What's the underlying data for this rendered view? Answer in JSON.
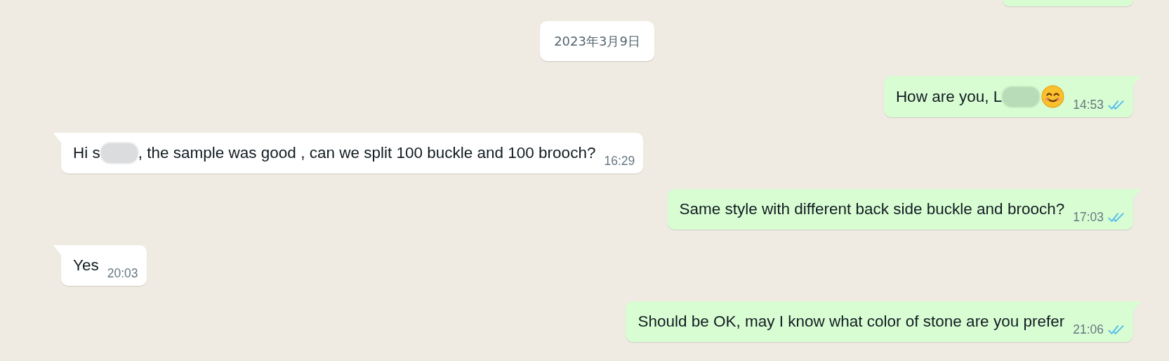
{
  "messages": [
    {
      "kind": "outgoing",
      "cropped": true
    },
    {
      "kind": "date",
      "text": "2023年3月9日"
    },
    {
      "kind": "outgoing",
      "parts": [
        {
          "kind": "text",
          "text": "How are you, L"
        },
        {
          "kind": "blur"
        },
        {
          "kind": "emoji"
        }
      ],
      "time": "14:53",
      "read": true
    },
    {
      "kind": "incoming",
      "parts": [
        {
          "kind": "text",
          "text": "Hi s"
        },
        {
          "kind": "blur"
        },
        {
          "kind": "text",
          "text": ", the sample was good , can we split 100 buckle and 100 brooch?"
        }
      ],
      "time": "16:29"
    },
    {
      "kind": "outgoing",
      "parts": [
        {
          "kind": "text",
          "text": "Same style with different back side buckle and brooch?"
        }
      ],
      "time": "17:03",
      "read": true
    },
    {
      "kind": "incoming",
      "parts": [
        {
          "kind": "text",
          "text": "Yes"
        }
      ],
      "time": "20:03"
    },
    {
      "kind": "outgoing",
      "parts": [
        {
          "kind": "text",
          "text": "Should be OK, may I know what color of stone are you prefer"
        }
      ],
      "time": "21:06",
      "read": true
    }
  ]
}
